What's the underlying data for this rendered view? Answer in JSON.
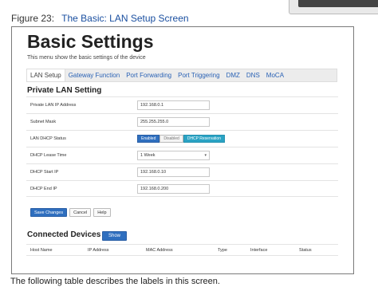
{
  "caption": {
    "number": "Figure 23:",
    "title": "The Basic: LAN Setup Screen"
  },
  "page": {
    "title": "Basic Settings",
    "subtitle": "This menu show the basic settings of the device"
  },
  "tabs": [
    "LAN Setup",
    "Gateway Function",
    "Port Forwarding",
    "Port Triggering",
    "DMZ",
    "DNS",
    "MoCA"
  ],
  "lan_section": {
    "title": "Private LAN Setting",
    "ip_label": "Private LAN IP Address",
    "ip_value": "192.168.0.1",
    "mask_label": "Subnet Mask",
    "mask_value": "255.255.255.0",
    "dhcp_label": "LAN DHCP Status",
    "dhcp_options": [
      "Enabled",
      "Disabled",
      "DHCP Reservation"
    ],
    "lease_label": "DHCP Lease Time",
    "lease_value": "1 Week",
    "start_label": "DHCP Start IP",
    "start_value": "192.168.0.10",
    "end_label": "DHCP End IP",
    "end_value": "192.168.0.200"
  },
  "buttons": {
    "save": "Save Changes",
    "cancel": "Cancel",
    "help": "Help"
  },
  "devices": {
    "title": "Connected Devices",
    "show": "Show",
    "columns": [
      "Host Name",
      "IP Address",
      "MAC Address",
      "Type",
      "Interface",
      "Status"
    ]
  },
  "footer": "The following table describes the labels in this screen."
}
